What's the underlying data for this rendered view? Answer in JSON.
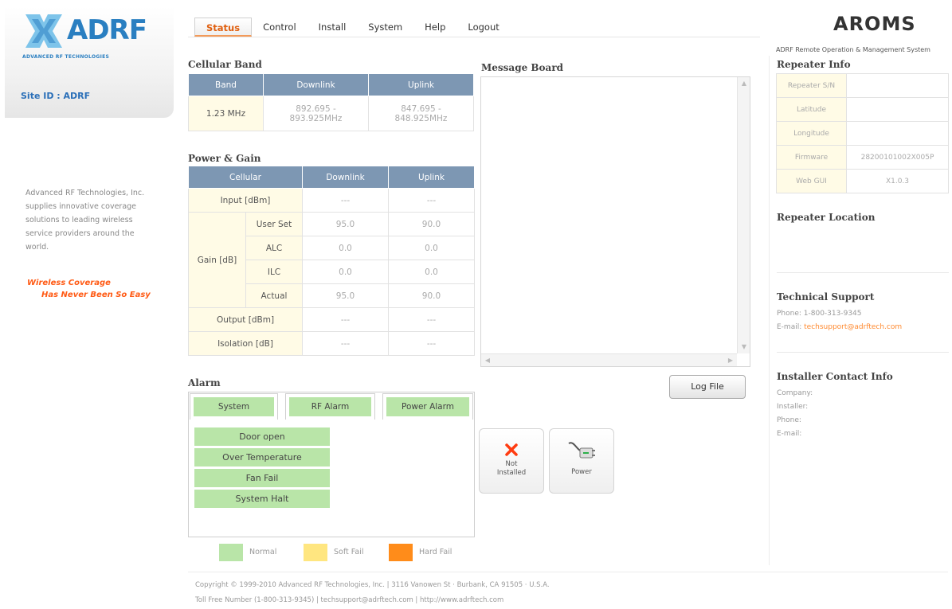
{
  "brand": {
    "logo_text": "ADRF",
    "logo_sub": "ADVANCED RF TECHNOLOGIES",
    "site_id": "Site ID : ADRF",
    "about": "Advanced RF Technologies, Inc. supplies innovative coverage solutions to leading wireless service providers around the world.",
    "tagline_1": "Wireless Coverage",
    "tagline_2": "Has Never Been So Easy",
    "accent_color": "#2a7fc1",
    "tagline_color": "#ff5a14"
  },
  "nav": {
    "tabs": [
      "Status",
      "Control",
      "Install",
      "System",
      "Help",
      "Logout"
    ],
    "active": "Status"
  },
  "header": {
    "title": "AROMS",
    "subtitle": "ADRF Remote Operation & Management System"
  },
  "cellular_band": {
    "title": "Cellular Band",
    "headers": [
      "Band",
      "Downlink",
      "Uplink"
    ],
    "band": "1.23 MHz",
    "downlink": "892.695 - 893.925MHz",
    "uplink": "847.695 - 848.925MHz"
  },
  "power_gain": {
    "title": "Power & Gain",
    "headers": [
      "Cellular",
      "Downlink",
      "Uplink"
    ],
    "input_label": "Input [dBm]",
    "input_dl": "---",
    "input_ul": "---",
    "gain_label": "Gain [dB]",
    "gain_rows": [
      {
        "label": "User Set",
        "dl": "95.0",
        "ul": "90.0"
      },
      {
        "label": "ALC",
        "dl": "0.0",
        "ul": "0.0"
      },
      {
        "label": "ILC",
        "dl": "0.0",
        "ul": "0.0"
      },
      {
        "label": "Actual",
        "dl": "95.0",
        "ul": "90.0"
      }
    ],
    "output_label": "Output [dBm]",
    "output_dl": "---",
    "output_ul": "---",
    "isolation_label": "Isolation [dB]",
    "isolation_dl": "---",
    "isolation_ul": "---"
  },
  "message_board": {
    "title": "Message Board",
    "log_button": "Log File"
  },
  "alarm": {
    "title": "Alarm",
    "tabs": [
      "System",
      "RF Alarm",
      "Power Alarm"
    ],
    "items": [
      "Door open",
      "Over Temperature",
      "Fan Fail",
      "System Halt"
    ],
    "legend": [
      {
        "label": "Normal",
        "color": "#b9e5a8"
      },
      {
        "label": "Soft Fail",
        "color": "#ffe680"
      },
      {
        "label": "Hard Fail",
        "color": "#ff8c1a"
      }
    ]
  },
  "status_buttons": {
    "not_installed_1": "Not",
    "not_installed_2": "Installed",
    "power": "Power"
  },
  "repeater_info": {
    "title": "Repeater Info",
    "rows": [
      {
        "label": "Repeater S/N",
        "value": ""
      },
      {
        "label": "Latitude",
        "value": ""
      },
      {
        "label": "Longitude",
        "value": ""
      },
      {
        "label": "Firmware",
        "value": "28200101002X005P"
      },
      {
        "label": "Web GUI",
        "value": "X1.0.3"
      }
    ]
  },
  "repeater_location": {
    "title": "Repeater Location"
  },
  "tech_support": {
    "title": "Technical Support",
    "phone": "Phone: 1-800-313-9345",
    "email_label": "E-mail: ",
    "email": "techsupport@adrftech.com"
  },
  "installer_contact": {
    "title": "Installer Contact Info",
    "lines": [
      "Company:",
      "Installer:",
      "Phone:",
      "E-mail:"
    ]
  },
  "footer": {
    "line1": "Copyright © 1999-2010 Advanced RF Technologies, Inc. | 3116 Vanowen St · Burbank, CA 91505 · U.S.A.",
    "line2": "Toll Free Number (1-800-313-9345) | techsupport@adrftech.com | http://www.adrftech.com"
  }
}
